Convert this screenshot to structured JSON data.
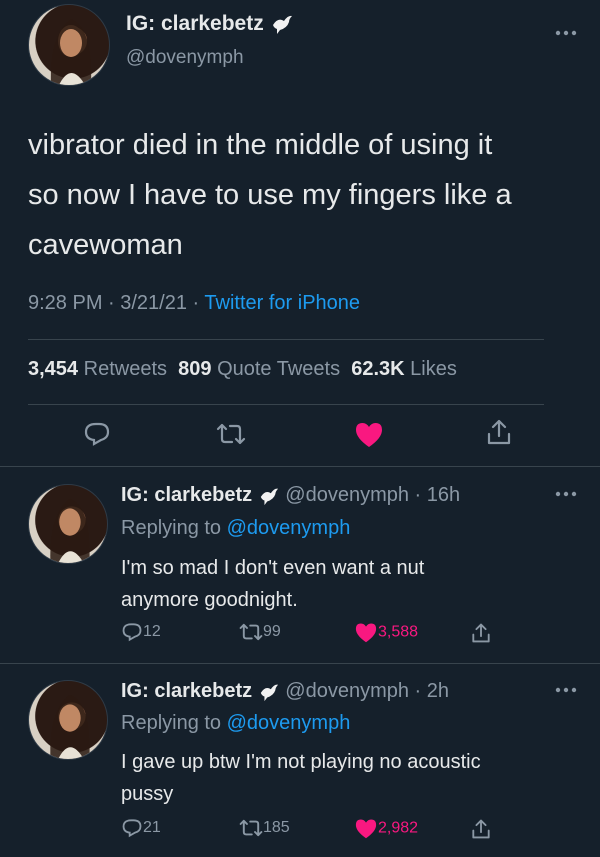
{
  "main_tweet": {
    "name": "IG: clarkebetz",
    "handle": "@dovenymph",
    "text_line1": "vibrator died in the middle of using it",
    "text_line2": "so now I have to use my fingers like a",
    "text_line3": "cavewoman",
    "time_date": "9:28 PM · 3/21/21 · ",
    "source": "Twitter for iPhone",
    "retweets_count": "3,454",
    "retweets_label": "Retweets",
    "quotes_count": "809",
    "quotes_label": "Quote Tweets",
    "likes_count": "62.3K",
    "likes_label": "Likes"
  },
  "replies": [
    {
      "name": "IG: clarkebetz",
      "handle_time": "@dovenymph · 16h",
      "replying_prefix": "Replying to ",
      "replying_handle": "@dovenymph",
      "text_line1": "I'm so mad I don't even want a nut",
      "text_line2": "anymore goodnight.",
      "reply_count": "12",
      "retweet_count": "99",
      "like_count": "3,588"
    },
    {
      "name": "IG: clarkebetz",
      "handle_time": "@dovenymph · 2h",
      "replying_prefix": "Replying to ",
      "replying_handle": "@dovenymph",
      "text_line1": "I gave up btw I'm not playing no acoustic",
      "text_line2": "pussy",
      "reply_count": "21",
      "retweet_count": "185",
      "like_count": "2,982"
    }
  ],
  "colors": {
    "background": "#15202b",
    "text": "#e7e9ea",
    "muted": "#8b98a5",
    "link": "#1d9bf0",
    "like": "#f91880",
    "divider": "#38444d"
  },
  "icons": [
    "more-icon",
    "dove-icon",
    "reply-icon",
    "retweet-icon",
    "heart-icon",
    "share-icon"
  ]
}
